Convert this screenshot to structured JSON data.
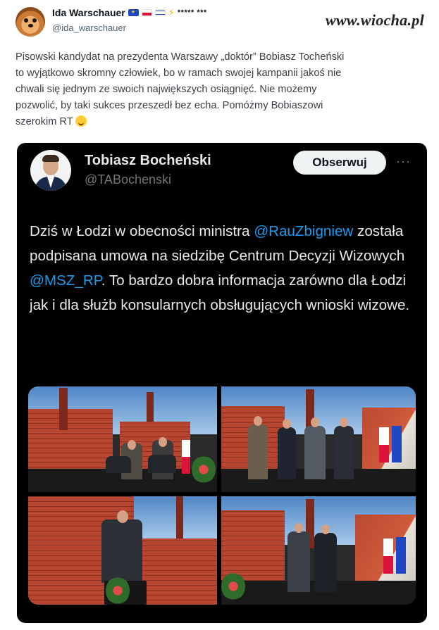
{
  "outer_tweet": {
    "author_name": "Ida Warschauer",
    "author_stars": "***** ***",
    "author_handle": "@ida_warschauer",
    "text": "Pisowski kandydat na prezydenta Warszawy „doktór” Bobiasz Tocheński\nto wyjątkowo skromny człowiek, bo w ramach swojej kampanii jakoś nie\nchwali się jednym ze swoich największych osiągnięć. Nie możemy\npozwolić, by taki sukces przeszedł bez echa. Pomóżmy Bobiaszowi\nszerokim RT",
    "badges": [
      "eu-flag-icon",
      "poland-flag-icon",
      "israel-flag-icon",
      "lightning-icon"
    ]
  },
  "watermark": "www.wiocha.pl",
  "quoted_tweet": {
    "author_name": "Tobiasz Bocheński",
    "author_handle": "@TABochenski",
    "follow_label": "Obserwuj",
    "more_label": "···",
    "text_part1": "Dziś w Łodzi w obecności ministra",
    "mention1": "@RauZbigniew",
    "text_part2": " została podpisana umowa na siedzibę Centrum Decyzji Wizowych ",
    "mention2": "@MSZ_RP",
    "text_part3": ". To bardzo dobra informacja zarówno dla Łodzi jak i dla służb konsularnych obsługujących wnioski wizowe.",
    "photos": [
      "signing-photo",
      "group-photo",
      "speaker-photo",
      "handshake-photo"
    ]
  },
  "colors": {
    "link": "#1d9bf0",
    "card_bg": "#000000",
    "card_text": "#e7e9ea"
  }
}
